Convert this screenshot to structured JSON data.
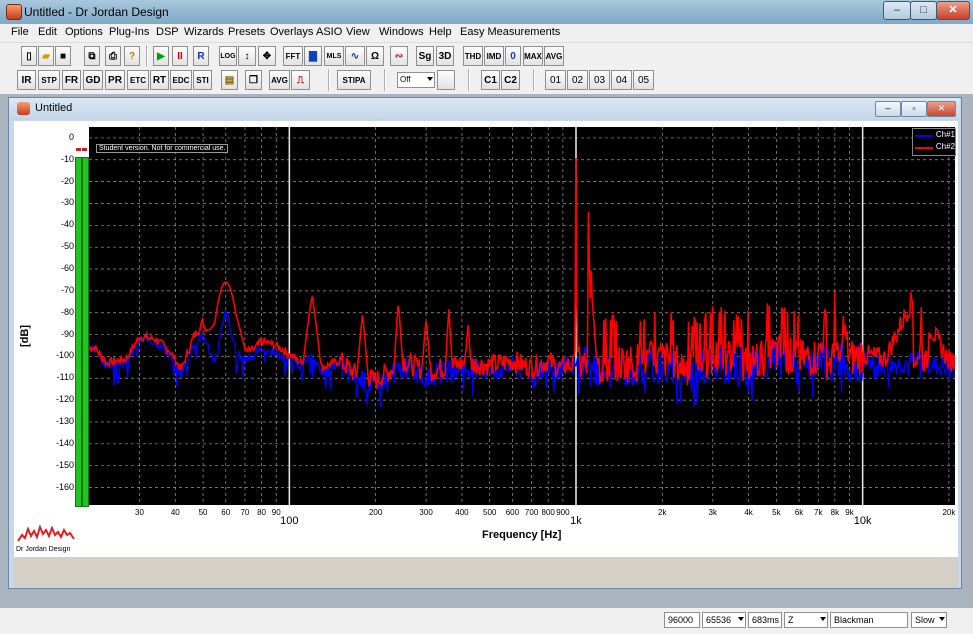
{
  "window": {
    "title": "Untitled - Dr Jordan Design",
    "minimize": "–",
    "maximize": "□",
    "close": "✕"
  },
  "menu": [
    "File",
    "Edit",
    "Options",
    "Plug-Ins",
    "DSP",
    "Wizards",
    "Presets",
    "Overlays",
    "ASIO",
    "View",
    "Windows",
    "Help",
    "Easy Measurements"
  ],
  "toolbar1": {
    "play": "▶",
    "pause": "II",
    "record": "R",
    "log": "LOG",
    "fft": "FFT",
    "mls": "MLS",
    "omega": "Ω",
    "sg": "Sg",
    "threed": "3D",
    "thd": "THD",
    "imd": "IMD",
    "zero": "0",
    "max": "MAX",
    "avg": "AVG"
  },
  "toolbar2": {
    "modes": [
      "IR",
      "STP",
      "FR",
      "GD",
      "PR",
      "ETC",
      "RT",
      "EDC",
      "STI"
    ],
    "avg": "AVG",
    "stipa": "STIPA",
    "off_select": "Off",
    "channels": [
      "C1",
      "C2"
    ],
    "presets": [
      "01",
      "02",
      "03",
      "04",
      "05"
    ]
  },
  "child": {
    "title": "Untitled"
  },
  "chart_data": {
    "type": "line",
    "title": "",
    "xlabel": "Frequency [Hz]",
    "ylabel": "[dB]",
    "xscale": "log",
    "xlim": [
      20,
      21000
    ],
    "ylim": [
      -168,
      5
    ],
    "y_ticks": [
      0,
      -10,
      -20,
      -30,
      -40,
      -50,
      -60,
      -70,
      -80,
      -90,
      -100,
      -110,
      -120,
      -130,
      -140,
      -150,
      -160
    ],
    "x_tick_labels": [
      {
        "v": 30,
        "t": "30"
      },
      {
        "v": 40,
        "t": "40"
      },
      {
        "v": 50,
        "t": "50"
      },
      {
        "v": 60,
        "t": "60"
      },
      {
        "v": 70,
        "t": "70"
      },
      {
        "v": 80,
        "t": "80"
      },
      {
        "v": 90,
        "t": "90"
      },
      {
        "v": 100,
        "t": "100",
        "major": true
      },
      {
        "v": 200,
        "t": "200"
      },
      {
        "v": 300,
        "t": "300"
      },
      {
        "v": 400,
        "t": "400"
      },
      {
        "v": 500,
        "t": "500"
      },
      {
        "v": 600,
        "t": "600"
      },
      {
        "v": 700,
        "t": "700"
      },
      {
        "v": 800,
        "t": "800"
      },
      {
        "v": 900,
        "t": "900"
      },
      {
        "v": 1000,
        "t": "1k",
        "major": true
      },
      {
        "v": 2000,
        "t": "2k"
      },
      {
        "v": 3000,
        "t": "3k"
      },
      {
        "v": 4000,
        "t": "4k"
      },
      {
        "v": 5000,
        "t": "5k"
      },
      {
        "v": 6000,
        "t": "6k"
      },
      {
        "v": 7000,
        "t": "7k"
      },
      {
        "v": 8000,
        "t": "8k"
      },
      {
        "v": 9000,
        "t": "9k"
      },
      {
        "v": 10000,
        "t": "10k",
        "major": true
      },
      {
        "v": 20000,
        "t": "20k"
      }
    ],
    "grid": true,
    "legend": "top-right",
    "annotation": "Student version. Not for commercial use.",
    "series": [
      {
        "name": "Ch#1",
        "color": "#0000ff",
        "x": [
          21,
          23,
          27,
          30,
          34,
          38,
          42,
          46,
          50,
          55,
          60,
          65,
          70,
          75,
          80,
          90,
          100,
          110,
          120,
          130,
          150,
          170,
          200,
          250,
          300,
          350,
          400,
          500,
          600,
          700,
          800,
          900,
          1000,
          1200,
          1500,
          2000,
          2500,
          3000,
          4000,
          5000,
          6000,
          7000,
          8000,
          9000,
          10000,
          12000,
          15000,
          20000
        ],
        "y": [
          -97,
          -104,
          -103,
          -92,
          -93,
          -99,
          -108,
          -95,
          -90,
          -103,
          -79,
          -98,
          -101,
          -100,
          -96,
          -99,
          -101,
          -104,
          -100,
          -107,
          -104,
          -110,
          -113,
          -104,
          -110,
          -107,
          -105,
          -106,
          -104,
          -107,
          -104,
          -108,
          -104,
          -106,
          -105,
          -104,
          -108,
          -103,
          -106,
          -101,
          -104,
          -103,
          -102,
          -104,
          -102,
          -104,
          -102,
          -105
        ]
      },
      {
        "name": "Ch#2",
        "color": "#ff0000",
        "x": [
          21,
          23,
          27,
          30,
          34,
          38,
          42,
          46,
          50,
          55,
          60,
          65,
          70,
          75,
          80,
          90,
          100,
          110,
          120,
          130,
          150,
          170,
          200,
          250,
          300,
          350,
          400,
          500,
          600,
          700,
          800,
          900,
          1000,
          1200,
          1500,
          2000,
          2500,
          3000,
          4000,
          5000,
          6000,
          7000,
          8000,
          9000,
          10000,
          12000,
          15000,
          20000
        ],
        "y": [
          -96,
          -103,
          -101,
          -91,
          -92,
          -97,
          -106,
          -92,
          -84,
          -100,
          -66,
          -95,
          -98,
          -97,
          -93,
          -95,
          -99,
          -103,
          -97,
          -105,
          -102,
          -108,
          -111,
          -102,
          -107,
          -105,
          -103,
          -104,
          -102,
          -105,
          -102,
          -106,
          1,
          -104,
          -103,
          -101,
          -105,
          -100,
          -103,
          -98,
          -101,
          -100,
          -66,
          -101,
          -99,
          -101,
          -73,
          -102
        ]
      }
    ],
    "peaks": [
      {
        "x": 60,
        "y": -66,
        "w": 0.07
      },
      {
        "x": 120,
        "y": -72,
        "w": 0.03
      },
      {
        "x": 180,
        "y": -80,
        "w": 0.02
      },
      {
        "x": 240,
        "y": -74,
        "w": 0.015
      },
      {
        "x": 300,
        "y": -82,
        "w": 0.015
      },
      {
        "x": 360,
        "y": -78,
        "w": 0.012
      },
      {
        "x": 420,
        "y": -85,
        "w": 0.01
      },
      {
        "x": 1000,
        "y": 1,
        "w": 0.004
      },
      {
        "x": 8000,
        "y": -66,
        "w": 0.004
      },
      {
        "x": 16000,
        "y": -73,
        "w": 0.004
      }
    ]
  },
  "vu": {
    "color": "#22c422"
  },
  "logo": {
    "text": "Dr Jordan Design"
  },
  "status": {
    "rate": "96000",
    "fft_size": "65536",
    "time": "683ms",
    "z": "Z",
    "window": "Blackman",
    "speed": "Slow"
  }
}
